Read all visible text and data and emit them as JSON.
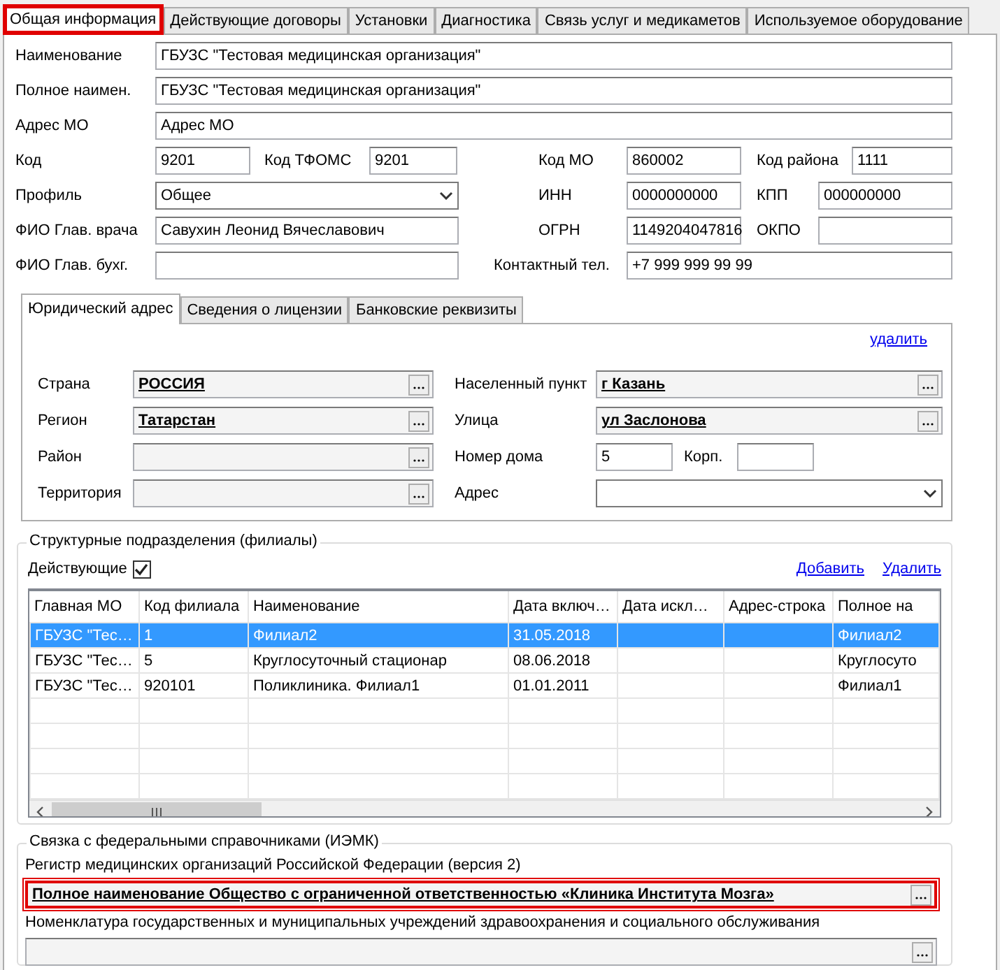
{
  "tabs": [
    {
      "label": "Общая информация",
      "selected": true,
      "highlighted": true
    },
    {
      "label": "Действующие договоры",
      "selected": false,
      "highlighted": false
    },
    {
      "label": "Установки",
      "selected": false,
      "highlighted": false
    },
    {
      "label": "Диагностика",
      "selected": false,
      "highlighted": false
    },
    {
      "label": "Связь услуг и медикаметов",
      "selected": false,
      "highlighted": false
    },
    {
      "label": "Используемое оборудование",
      "selected": false,
      "highlighted": false
    }
  ],
  "general": {
    "name": {
      "label": "Наименование",
      "value": "ГБУЗС \"Тестовая медицинская организация\""
    },
    "full_name": {
      "label": "Полное наимен.",
      "value": "ГБУЗС \"Тестовая медицинская организация\""
    },
    "address_mo": {
      "label": "Адрес МО",
      "value": "Адрес МО"
    },
    "code": {
      "label": "Код",
      "value": "9201"
    },
    "tfoms_code": {
      "label": "Код ТФОМС",
      "value": "9201"
    },
    "mo_code": {
      "label": "Код МО",
      "value": "860002"
    },
    "district_code": {
      "label": "Код района",
      "value": "1111"
    },
    "profile": {
      "label": "Профиль",
      "value": "Общее"
    },
    "inn": {
      "label": "ИНН",
      "value": "0000000000"
    },
    "kpp": {
      "label": "КПП",
      "value": "000000000"
    },
    "chief_doctor": {
      "label": "ФИО Глав. врача",
      "value": "Савухин Леонид Вячеславович"
    },
    "ogrn": {
      "label": "ОГРН",
      "value": "1149204047816"
    },
    "okpo": {
      "label": "ОКПО"
    },
    "chief_accountant": {
      "label": "ФИО Глав. бухг."
    },
    "phone": {
      "label": "Контактный тел.",
      "value": "+7 999 999 99 99"
    }
  },
  "address_tabs": [
    {
      "label": "Юридический адрес",
      "selected": true
    },
    {
      "label": "Сведения о лицензии",
      "selected": false
    },
    {
      "label": "Банковские реквизиты",
      "selected": false
    }
  ],
  "address_delete_link": "удалить",
  "address_left": [
    {
      "label": "Страна",
      "value": "РОССИЯ"
    },
    {
      "label": "Регион",
      "value": "Татарстан"
    },
    {
      "label": "Район"
    },
    {
      "label": "Территория"
    }
  ],
  "address_right": [
    {
      "kind": "lookup",
      "label": "Населенный пункт",
      "value": "г Казань"
    },
    {
      "kind": "lookup",
      "label": "Улица",
      "value": "ул Заслонова"
    },
    {
      "kind": "house",
      "label": "Номер дома",
      "value": "5",
      "extra_label": "Корп."
    },
    {
      "kind": "combo",
      "label": "Адрес"
    }
  ],
  "branches": {
    "title": "Структурные подразделения (филиалы)",
    "active_label": "Действующие",
    "active_checked": true,
    "add_link": "Добавить",
    "delete_link": "Удалить",
    "columns": [
      "Главная МО",
      "Код филиала",
      "Наименование",
      "Дата включ…",
      "Дата искл…",
      "Адрес-строка",
      "Полное на"
    ],
    "rows": [
      {
        "selected": true,
        "cells": [
          "ГБУЗС \"Тес…",
          "1",
          "Филиал2",
          "31.05.2018",
          "",
          "",
          "Филиал2"
        ]
      },
      {
        "selected": false,
        "cells": [
          "ГБУЗС \"Тес…",
          "5",
          "Круглосуточный стационар",
          "08.06.2018",
          "",
          "",
          "Круглосуто"
        ]
      },
      {
        "selected": false,
        "cells": [
          "ГБУЗС \"Тес…",
          "920101",
          "Поликлиника. Филиал1",
          "01.01.2011",
          "",
          "",
          "Филиал1"
        ]
      }
    ]
  },
  "federal": {
    "title": "Связка с федеральными справочниками (ИЭМК)",
    "registry_label": "Регистр медицинских организаций Российской Федерации (версия 2)",
    "registry_value": "Полное наименование Общество с ограниченной ответственностью «Клиника Института Мозга»",
    "registry_highlighted": true,
    "nomenclature_label": "Номенклатура государственных и муниципальных учреждений здравоохранения и социального обслуживания"
  }
}
